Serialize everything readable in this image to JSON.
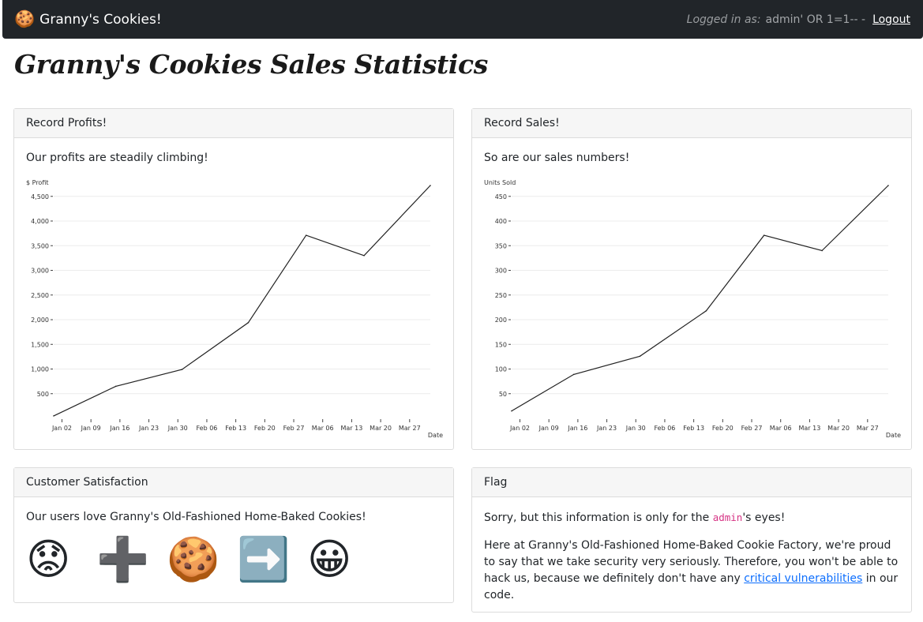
{
  "nav": {
    "brand_icon": "🍪",
    "brand": "Granny's Cookies!",
    "logged_in_label": "Logged in as:",
    "logged_in_user": "admin' OR 1=1-- -",
    "logout": "Logout"
  },
  "page_title": "Granny's Cookies Sales Statistics",
  "profits": {
    "header": "Record Profits!",
    "text": "Our profits are steadily climbing!"
  },
  "sales": {
    "header": "Record Sales!",
    "text": "So are our sales numbers!"
  },
  "satisfaction": {
    "header": "Customer Satisfaction",
    "text": "Our users love Granny's Old-Fashioned Home-Baked Cookies!",
    "emojis": [
      "😟",
      "➕",
      "🍪",
      "➡️",
      "😀"
    ],
    "emoji_names": [
      "worried-face-icon",
      "plus-icon",
      "cookie-icon",
      "right-arrow-icon",
      "grinning-face-icon"
    ]
  },
  "flag": {
    "header": "Flag",
    "p1_before": "Sorry, but this information is only for the ",
    "p1_code": "admin",
    "p1_after": "'s eyes!",
    "p2_before": "Here at Granny's Old-Fashioned Home-Baked Cookie Factory, we're proud to say that we take security very seriously. Therefore, you won't be able to hack us, because we definitely don't have any ",
    "p2_link": "critical vulnerabilities",
    "p2_after": " in our code."
  },
  "chart_data": [
    {
      "type": "line",
      "ylabel": "$ Profit",
      "xlabel": "Date",
      "ylim": [
        0,
        4800
      ],
      "y_ticks": [
        500,
        1000,
        1500,
        2000,
        2500,
        3000,
        3500,
        4000,
        4500
      ],
      "y_tick_labels": [
        "500",
        "1,000",
        "1,500",
        "2,000",
        "2,500",
        "3,000",
        "3,500",
        "4,000",
        "4,500"
      ],
      "x_tick_labels": [
        "Jan 02",
        "Jan 09",
        "Jan 16",
        "Jan 23",
        "Jan 30",
        "Feb 06",
        "Feb 13",
        "Feb 20",
        "Feb 27",
        "Mar 06",
        "Mar 13",
        "Mar 20",
        "Mar 27"
      ],
      "x": [
        "Dec 31",
        "Jan 15",
        "Jan 31",
        "Feb 16",
        "Mar 02",
        "Mar 16",
        "Apr 01"
      ],
      "values": [
        50,
        650,
        990,
        1940,
        3710,
        3300,
        4720
      ],
      "grid": true,
      "line_color": "#222222"
    },
    {
      "type": "line",
      "ylabel": "Units Sold",
      "xlabel": "Date",
      "ylim": [
        0,
        480
      ],
      "y_ticks": [
        50,
        100,
        150,
        200,
        250,
        300,
        350,
        400,
        450
      ],
      "y_tick_labels": [
        "50",
        "100",
        "150",
        "200",
        "250",
        "300",
        "350",
        "400",
        "450"
      ],
      "x_tick_labels": [
        "Jan 02",
        "Jan 09",
        "Jan 16",
        "Jan 23",
        "Jan 30",
        "Feb 06",
        "Feb 13",
        "Feb 20",
        "Feb 27",
        "Mar 06",
        "Mar 13",
        "Mar 20",
        "Mar 27"
      ],
      "x": [
        "Dec 31",
        "Jan 15",
        "Jan 31",
        "Feb 16",
        "Mar 02",
        "Mar 16",
        "Apr 01"
      ],
      "values": [
        15,
        89,
        126,
        218,
        371,
        340,
        472
      ],
      "grid": true,
      "line_color": "#222222"
    }
  ]
}
